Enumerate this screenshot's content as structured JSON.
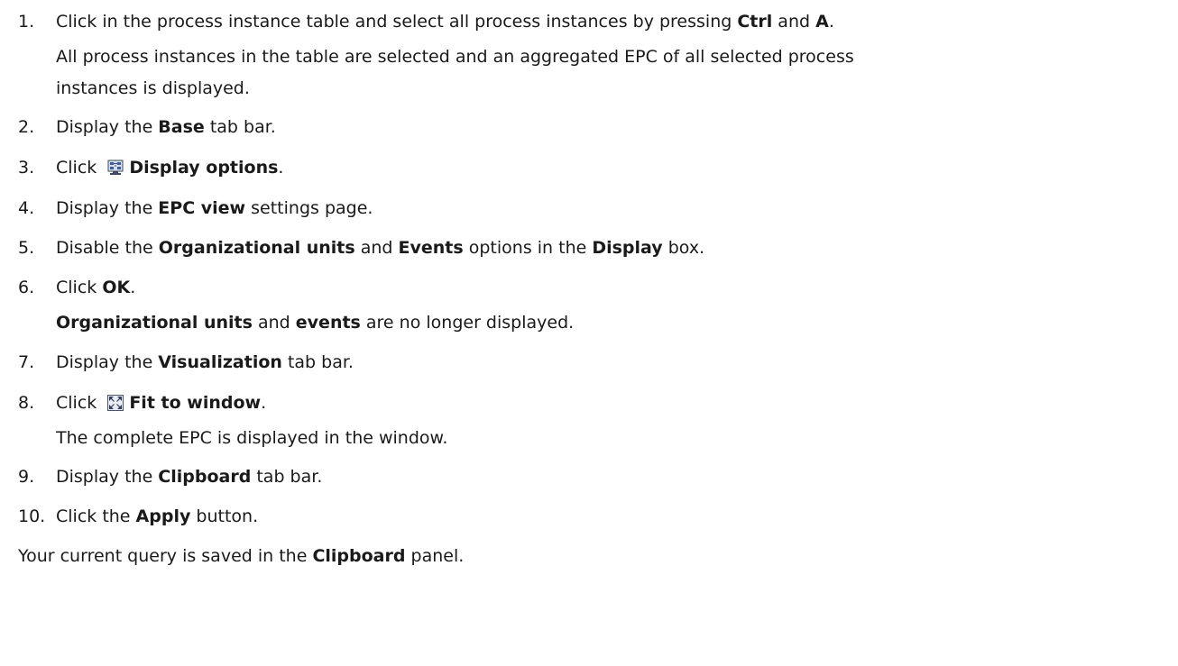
{
  "steps": [
    {
      "number": "1.",
      "pre": "Click in the process instance table and select all process instances by pressing ",
      "b1": "Ctrl",
      "mid": " and ",
      "b2": "A",
      "post": ".",
      "result_line1": "All process instances in the table are selected and an aggregated EPC of all selected process",
      "result_line2": "instances is displayed."
    },
    {
      "number": "2.",
      "pre": "Display the ",
      "bold": "Base",
      "post": " tab bar."
    },
    {
      "number": "3.",
      "pre": "Click ",
      "icon": "display-options-icon",
      "bold": "Display options",
      "post": "."
    },
    {
      "number": "4.",
      "pre": "Display the ",
      "bold": "EPC view",
      "post": " settings page."
    },
    {
      "number": "5.",
      "pre": "Disable the ",
      "b1": "Organizational units",
      "mid1": " and ",
      "b2": "Events",
      "mid2": " options in the ",
      "b3": "Display",
      "post": " box."
    },
    {
      "number": "6.",
      "pre": "Click ",
      "bold": "OK",
      "post": ".",
      "result_b1": "Organizational units",
      "result_mid": " and ",
      "result_b2": "events",
      "result_post": " are no longer displayed."
    },
    {
      "number": "7.",
      "pre": "Display the ",
      "bold": "Visualization",
      "post": " tab bar."
    },
    {
      "number": "8.",
      "pre": "Click ",
      "icon": "fit-to-window-icon",
      "bold": "Fit to window",
      "post": ".",
      "result": "The complete EPC is displayed in the window."
    },
    {
      "number": "9.",
      "pre": "Display the ",
      "bold": "Clipboard",
      "post": " tab bar."
    },
    {
      "number": "10.",
      "pre": "Click the ",
      "bold": "Apply",
      "post": " button."
    }
  ],
  "footer": {
    "pre": "Your current query is saved in the ",
    "bold": "Clipboard",
    "post": " panel."
  }
}
